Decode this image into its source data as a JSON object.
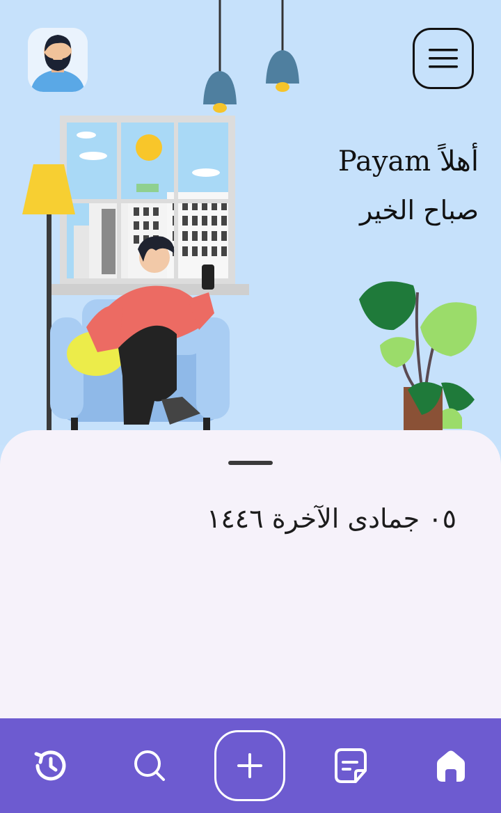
{
  "header": {
    "greeting_hello": "أهلاً Payam",
    "greeting_morning": "صباح الخير"
  },
  "sheet": {
    "date": "٠٥ جمادى الآخرة ١٤٤٦"
  },
  "icons": {
    "avatar": "avatar",
    "menu": "hamburger-menu-icon",
    "nav": [
      "history-icon",
      "search-icon",
      "plus-icon",
      "document-icon",
      "home-icon"
    ]
  },
  "colors": {
    "hero_bg": "#c6e1fb",
    "sheet_bg": "#f6f2fa",
    "nav_bg": "#6d5bd0",
    "accent_white": "#ffffff"
  }
}
